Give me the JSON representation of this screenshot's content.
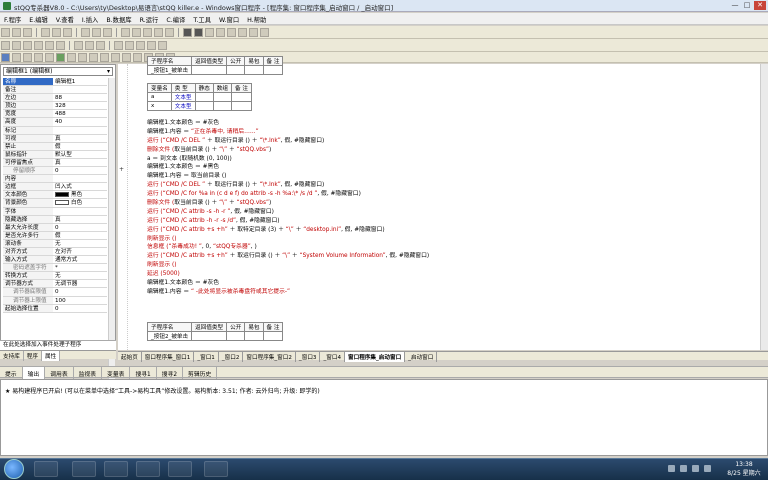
{
  "window": {
    "title": "stQQ专杀器V8.0 - C:\\Users\\ty\\Desktop\\易语言\\stQQ killer.e - Windows窗口程序 - [程序集: 窗口程序集_启动窗口 / _启动窗口]",
    "controls": [
      "—",
      "□",
      "✕"
    ]
  },
  "menu": [
    "F.程序",
    "E.编辑",
    "V.查看",
    "I.插入",
    "B.数据库",
    "R.运行",
    "C.编译",
    "T.工具",
    "W.窗口",
    "H.帮助"
  ],
  "left_panel": {
    "combo": "编辑框1 (编辑框)",
    "properties": [
      {
        "k": "名称",
        "v": "编辑框1",
        "kind": "sel"
      },
      {
        "k": "备注",
        "v": ""
      },
      {
        "k": "左边",
        "v": "88"
      },
      {
        "k": "顶边",
        "v": "328"
      },
      {
        "k": "宽度",
        "v": "488"
      },
      {
        "k": "高度",
        "v": "40"
      },
      {
        "k": "标记",
        "v": ""
      },
      {
        "k": "可视",
        "v": "真"
      },
      {
        "k": "禁止",
        "v": "假"
      },
      {
        "k": "鼠标指针",
        "v": "默认型"
      },
      {
        "k": "可停留焦点",
        "v": "真"
      },
      {
        "k": "停留顺序",
        "v": "0",
        "kind": "sub"
      },
      {
        "k": "内容",
        "v": ""
      },
      {
        "k": "边框",
        "v": "凹入式"
      },
      {
        "k": "文本颜色",
        "v": "黑色",
        "swatch": "#000000"
      },
      {
        "k": "背景颜色",
        "v": "白色",
        "swatch": "#ffffff"
      },
      {
        "k": "字体",
        "v": ""
      },
      {
        "k": "隐藏选择",
        "v": "真"
      },
      {
        "k": "最大允许长度",
        "v": "0"
      },
      {
        "k": "是否允许多行",
        "v": "假"
      },
      {
        "k": "滚动条",
        "v": "无"
      },
      {
        "k": "对齐方式",
        "v": "左对齐"
      },
      {
        "k": "输入方式",
        "v": "通常方式"
      },
      {
        "k": "密码遮盖字符",
        "v": "*",
        "kind": "sub"
      },
      {
        "k": "转换方式",
        "v": "无"
      },
      {
        "k": "调节器方式",
        "v": "无调节器"
      },
      {
        "k": "调节器底限值",
        "v": "0",
        "kind": "sub"
      },
      {
        "k": "调节器上限值",
        "v": "100",
        "kind": "sub"
      },
      {
        "k": "起始选择位置",
        "v": "0"
      }
    ],
    "bottom_text": "在此处选择加入事件处理子程序",
    "tabs": [
      "支持库",
      "程序",
      "属性"
    ]
  },
  "editor": {
    "sub_header1": {
      "cols": [
        "子程序名",
        "返回值类型",
        "公开",
        "易包",
        "备 注"
      ],
      "name": "_按钮1_被单击"
    },
    "var_table": {
      "cols": [
        "变量名",
        "类 型",
        "静态",
        "数组",
        "备 注"
      ],
      "rows": [
        [
          "a",
          "文本型"
        ],
        [
          "x",
          "文本型"
        ]
      ]
    },
    "lines": [
      [
        {
          "t": "编辑框1.文本颜色 ＝ #灰色",
          "c": "kw"
        }
      ],
      [
        {
          "t": "编辑框1.内容 ＝ ",
          "c": "kw"
        },
        {
          "t": "“正在杀毒中, 请稍后……”",
          "c": "red"
        }
      ],
      [
        {
          "t": "运行 (",
          "c": "cmd"
        },
        {
          "t": "“CMD /C DEL ”",
          "c": "red"
        },
        {
          "t": " ＋ 取运行目录 () ＋ ",
          "c": "kw"
        },
        {
          "t": "“\\*.lnk”",
          "c": "red"
        },
        {
          "t": ", 假, #隐藏窗口)",
          "c": "kw"
        }
      ],
      [
        {
          "t": "删除文件 (",
          "c": "cmd"
        },
        {
          "t": "取当前目录 () ＋ ",
          "c": "kw"
        },
        {
          "t": "“\\”",
          "c": "red"
        },
        {
          "t": " ＋ ",
          "c": "kw"
        },
        {
          "t": "“stQQ.vbs”",
          "c": "red"
        },
        {
          "t": ")",
          "c": "kw"
        }
      ],
      [
        {
          "t": "a ＝ 到文本 (取随机数 (0, 100))",
          "c": "kw"
        }
      ],
      [
        {
          "t": "编辑框1.文本颜色 ＝ #黑色",
          "c": "kw"
        }
      ],
      [
        {
          "t": "编辑框1.内容 ＝ 取当前目录 ()",
          "c": "kw"
        }
      ],
      [
        {
          "t": "运行 (",
          "c": "cmd"
        },
        {
          "t": "“CMD /C DEL ”",
          "c": "red"
        },
        {
          "t": " ＋ 取运行目录 () ＋ ",
          "c": "kw"
        },
        {
          "t": "“\\*.lnk”",
          "c": "red"
        },
        {
          "t": ", 假, #隐藏窗口)",
          "c": "kw"
        }
      ],
      [
        {
          "t": "运行 (",
          "c": "cmd"
        },
        {
          "t": "“CMD /C for %a in (c d e f) do attrib -s -h %a:\\* /s /d ”",
          "c": "red"
        },
        {
          "t": ", 假, #隐藏窗口)",
          "c": "kw"
        }
      ],
      [
        {
          "t": "删除文件 (",
          "c": "cmd"
        },
        {
          "t": "取当前目录 () ＋ ",
          "c": "kw"
        },
        {
          "t": "“\\”",
          "c": "red"
        },
        {
          "t": " ＋ ",
          "c": "kw"
        },
        {
          "t": "“stQQ.vbs”",
          "c": "red"
        },
        {
          "t": ")",
          "c": "kw"
        }
      ],
      [
        {
          "t": "运行 (",
          "c": "cmd"
        },
        {
          "t": "“CMD /C attrib -s -h -r ”",
          "c": "red"
        },
        {
          "t": ", 假, #隐藏窗口)",
          "c": "kw"
        }
      ],
      [
        {
          "t": "运行 (",
          "c": "cmd"
        },
        {
          "t": "“CMD /C attrib -h -r -s /d”",
          "c": "red"
        },
        {
          "t": ", 假, #隐藏窗口)",
          "c": "kw"
        }
      ],
      [
        {
          "t": "运行 (",
          "c": "cmd"
        },
        {
          "t": "“CMD /C attrib +s +h”",
          "c": "red"
        },
        {
          "t": " ＋ 取特定目录 (3) ＋ ",
          "c": "kw"
        },
        {
          "t": "“\\”",
          "c": "red"
        },
        {
          "t": " ＋ ",
          "c": "kw"
        },
        {
          "t": "“desktop.ini”",
          "c": "red"
        },
        {
          "t": ", 假, #隐藏窗口)",
          "c": "kw"
        }
      ],
      [
        {
          "t": "刷新显示 ()",
          "c": "cmd"
        }
      ],
      [
        {
          "t": "信息框 (",
          "c": "cmd"
        },
        {
          "t": "“杀毒成功! ”",
          "c": "red"
        },
        {
          "t": ", 0, ",
          "c": "kw"
        },
        {
          "t": "“stQQ专杀器”",
          "c": "red"
        },
        {
          "t": ", )",
          "c": "kw"
        }
      ],
      [
        {
          "t": "运行 (",
          "c": "cmd"
        },
        {
          "t": "“CMD /C attrib +s +h”",
          "c": "red"
        },
        {
          "t": " ＋ 取运行目录 () ＋ ",
          "c": "kw"
        },
        {
          "t": "“\\”",
          "c": "red"
        },
        {
          "t": " ＋ ",
          "c": "kw"
        },
        {
          "t": "“System Volume Information”",
          "c": "red"
        },
        {
          "t": ", 假, #隐藏窗口)",
          "c": "kw"
        }
      ],
      [
        {
          "t": "刷新显示 ()",
          "c": "cmd"
        }
      ],
      [
        {
          "t": "延迟 (5000)",
          "c": "cmd"
        }
      ],
      [
        {
          "t": "编辑框1.文本颜色 ＝ #灰色",
          "c": "kw"
        }
      ],
      [
        {
          "t": "编辑框1.内容 ＝ ",
          "c": "kw"
        },
        {
          "t": "“                         -此处将显示被杀毒盘符或其它提示-”",
          "c": "red"
        }
      ]
    ],
    "sub_header2": {
      "cols": [
        "子程序名",
        "返回值类型",
        "公开",
        "易包",
        "备 注"
      ],
      "name": "_按钮2_被单击"
    },
    "doc_tabs": [
      "起始页",
      "窗口程序集_窗口1",
      "_窗口1",
      "_窗口2",
      "窗口程序集_窗口2",
      "_窗口3",
      "_窗口4",
      "窗口程序集_启动窗口",
      "_启动窗口"
    ]
  },
  "output": {
    "tabs": [
      "提示",
      "输出",
      "调用表",
      "监视表",
      "变量表",
      "搜寻1",
      "搜寻2",
      "剪辑历史"
    ],
    "line": "★ 易构建程序已开启! (可以在菜单中选择“工具->易构工具”修改设置。易构新本: 3.51; 作者: 云外归鸟; 升级: 即学的)"
  },
  "taskbar": {
    "time": "13:38",
    "date": "8/25 星期六"
  }
}
